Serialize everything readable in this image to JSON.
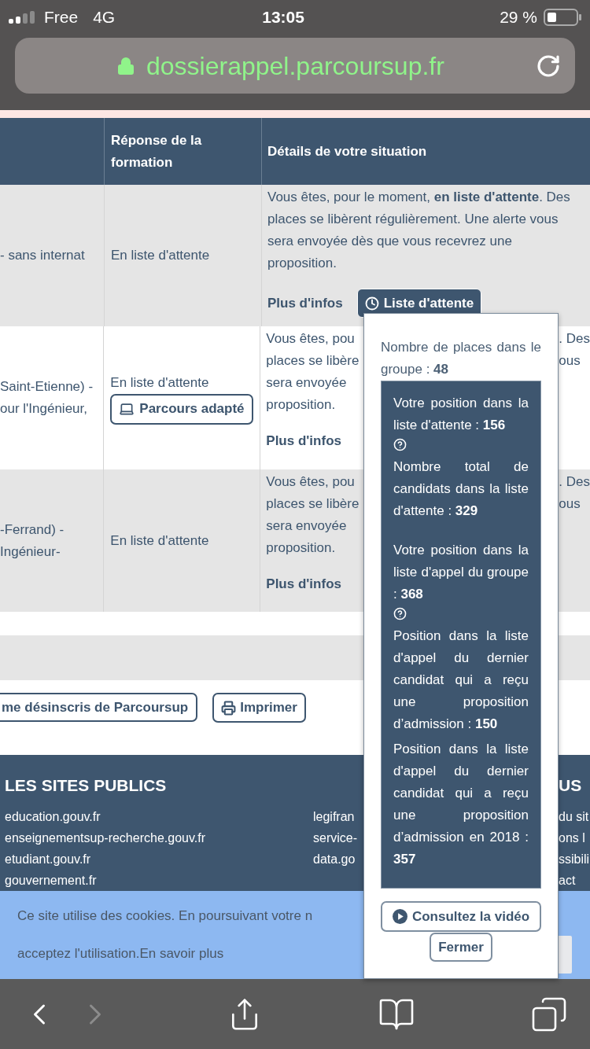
{
  "status_bar": {
    "carrier": "Free",
    "network": "4G",
    "time": "13:05",
    "battery": "29 %"
  },
  "address_bar": {
    "url": "dossierappel.parcoursup.fr"
  },
  "table": {
    "columns": [
      "Réponse de la formation",
      "Détails de votre situation"
    ],
    "rows": [
      {
        "cell_1": [
          "- sans internat"
        ],
        "response": "En liste d'attente",
        "details": [
          {
            "left": "Vous êtes, pour le moment, **en liste d'attente**. Des"
          },
          {
            "left": "places se libèrent régulièrement. Une alerte vous"
          },
          {
            "left": "sera envoyée dès que vous recevrez une"
          },
          {
            "left": "proposition."
          }
        ],
        "more": "Plus d'infos",
        "status_button": "Liste d'attente"
      },
      {
        "cell_1": [
          "Saint-Etienne) -",
          "our l'Ingénieur,"
        ],
        "response": "En liste d'attente",
        "adapted_button": "Parcours adapté",
        "details": [
          {
            "left": "Vous êtes, pou",
            "right": ". Des"
          },
          {
            "left": "places se libère",
            "right": "ous"
          },
          {
            "left": "sera envoyée"
          },
          {
            "left": "proposition."
          }
        ],
        "more": "Plus d'infos"
      },
      {
        "cell_1": [
          "-Ferrand) -",
          "Ingénieur-"
        ],
        "response": "En liste d'attente",
        "details": [
          {
            "left": "Vous êtes, pou",
            "right": ". Des"
          },
          {
            "left": "places se libère",
            "right": "ous"
          },
          {
            "left": "sera envoyée"
          },
          {
            "left": "proposition."
          }
        ],
        "more": "Plus d'infos"
      }
    ]
  },
  "popover": {
    "group_places": "Nombre de places dans le groupe : **48**",
    "stats": [
      {
        "text": "Votre position dans la liste d'attente : **156**",
        "help": true
      },
      {
        "text": "Nombre total de candidats dans la liste d'attente : **329**",
        "help": false
      },
      {
        "text": "Votre position dans la liste d'appel du groupe : **368**",
        "help": true
      },
      {
        "text": "Position dans la liste d'appel du dernier candidat qui a reçu une proposition d’admission : **150**",
        "help": false
      },
      {
        "text": "Position dans la liste d'appel du dernier candidat qui a reçu une proposition d’admission en 2018 : **357**",
        "help": false
      }
    ],
    "video_button": "Consultez la vidéo",
    "close_button": "Fermer"
  },
  "actions": {
    "unsubscribe": "me désinscris de Parcoursup",
    "print": "Imprimer"
  },
  "footer": {
    "title": "LES SITES PUBLICS",
    "links": [
      "education.gouv.fr",
      "enseignementsup-recherche.gouv.fr",
      "etudiant.gouv.fr",
      "gouvernement.fr"
    ],
    "links_2": [
      "legifran",
      "service-",
      "data.go"
    ],
    "title_3": "US",
    "links_3": [
      "du sit",
      "ons l",
      "ssibili",
      "act"
    ]
  },
  "cookie_banner": {
    "text": "Ce site utilise des cookies. En poursuivant votre n",
    "text_2": "acceptez l'utilisation.",
    "link": "En savoir plus"
  },
  "toolbar": {
    "forward_disabled": true
  }
}
